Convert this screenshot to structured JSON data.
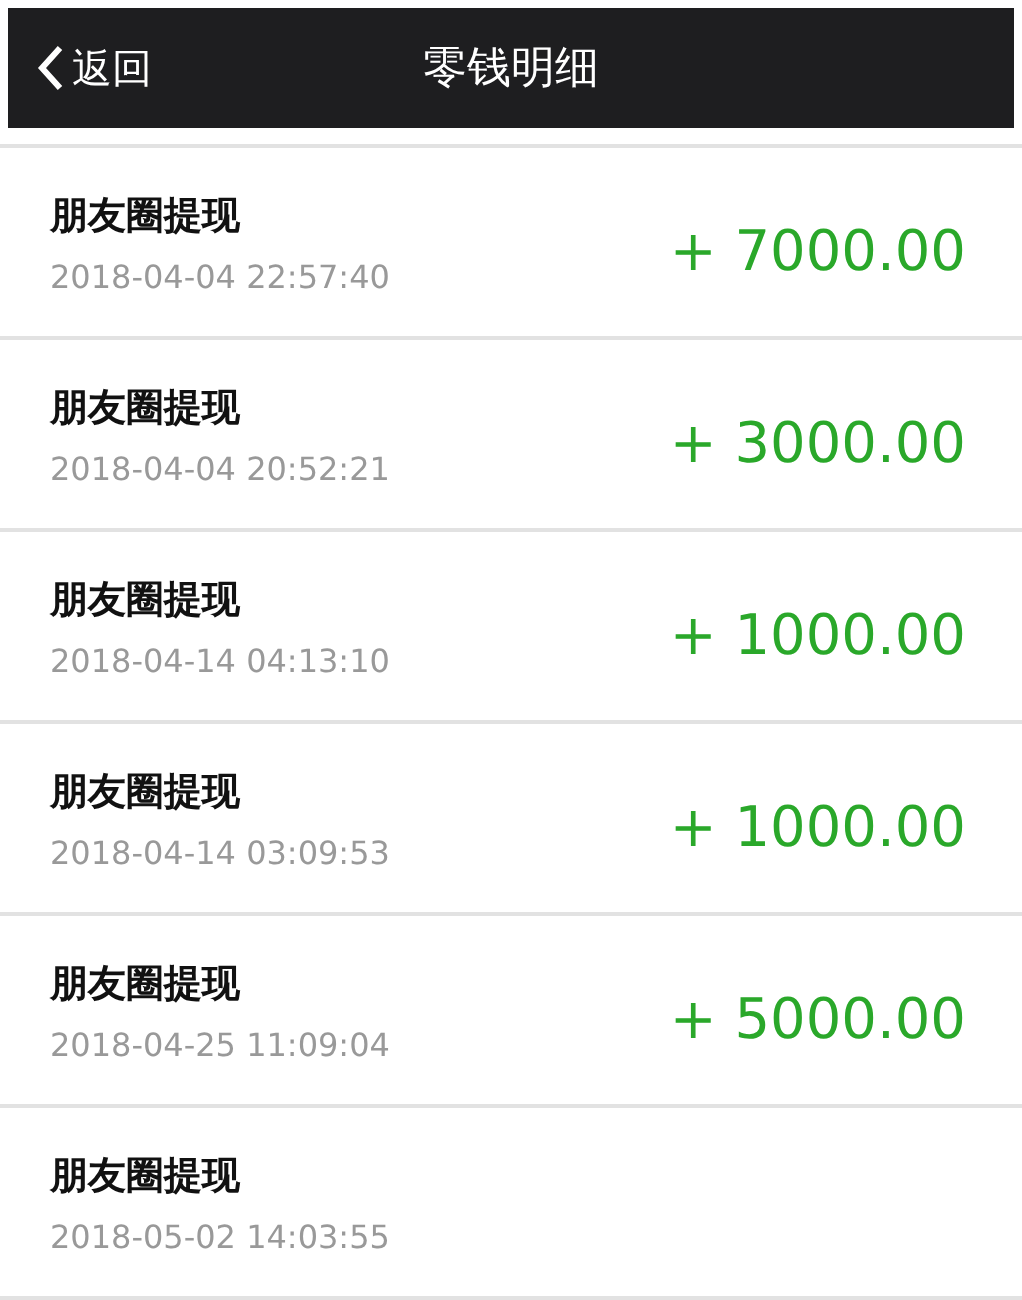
{
  "nav": {
    "back": "返回",
    "title": "零钱明细"
  },
  "records": [
    {
      "title": "朋友圈提现",
      "time": "2018-04-04 22:57:40",
      "amount": "+ 7000.00"
    },
    {
      "title": "朋友圈提现",
      "time": "2018-04-04 20:52:21",
      "amount": "+ 3000.00"
    },
    {
      "title": "朋友圈提现",
      "time": "2018-04-14 04:13:10",
      "amount": "+ 1000.00"
    },
    {
      "title": "朋友圈提现",
      "time": "2018-04-14 03:09:53",
      "amount": "+ 1000.00"
    },
    {
      "title": "朋友圈提现",
      "time": "2018-04-25 11:09:04",
      "amount": "+ 5000.00"
    },
    {
      "title": "朋友圈提现",
      "time": "2018-05-02 14:03:55"
    }
  ]
}
